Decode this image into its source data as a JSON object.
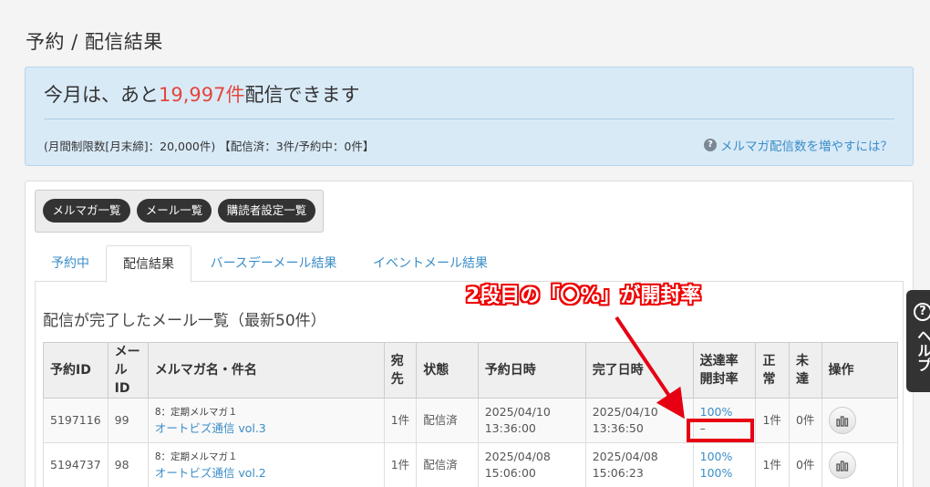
{
  "page": {
    "title": "予約 / 配信結果"
  },
  "quota": {
    "prefix": "今月は、あと",
    "count": "19,997件",
    "suffix": "配信できます",
    "detail": "(月間制限数[月末締]：20,000件) 【配信済：3件/予約中：0件】",
    "help_link": "メルマガ配信数を増やすには？"
  },
  "buttons": [
    "メルマガ一覧",
    "メール一覧",
    "購読者設定一覧"
  ],
  "tabs": [
    "予約中",
    "配信結果",
    "バースデーメール結果",
    "イベントメール結果"
  ],
  "active_tab": "配信結果",
  "section_title": "配信が完了したメール一覧（最新50件）",
  "table": {
    "headers": {
      "reserve_id": "予約ID",
      "mail_id": "メールID",
      "name": "メルマガ名・件名",
      "dest": "宛先",
      "status": "状態",
      "reserve_date": "予約日時",
      "done_date": "完了日時",
      "rates": "送達率 開封率",
      "normal": "正常",
      "failed": "未達",
      "ops": "操作"
    },
    "rows": [
      {
        "reserve_id": "5197116",
        "mail_id": "99",
        "magazine": "8：定期メルマガ１",
        "subject": "オートビズ通信 vol.3",
        "dest": "1件",
        "status": "配信済",
        "reserve_date": "2025/04/10 13:36:00",
        "done_date": "2025/04/10 13:36:50",
        "delivery_rate": "100%",
        "open_rate": "–",
        "normal": "1件",
        "failed": "0件"
      },
      {
        "reserve_id": "5194737",
        "mail_id": "98",
        "magazine": "8：定期メルマガ１",
        "subject": "オートビズ通信 vol.2",
        "dest": "1件",
        "status": "配信済",
        "reserve_date": "2025/04/08 15:06:00",
        "done_date": "2025/04/08 15:06:23",
        "delivery_rate": "100%",
        "open_rate": "100%",
        "normal": "1件",
        "failed": "0件"
      }
    ]
  },
  "annotation": {
    "text": "2段目の「〇%」が開封率",
    "color": "#e60012"
  },
  "help_tab": {
    "text": "ヘルプ"
  },
  "colors": {
    "accent": "#3a8dc7",
    "highlight": "#e3463d",
    "quota_bg": "#d9eaf7"
  }
}
